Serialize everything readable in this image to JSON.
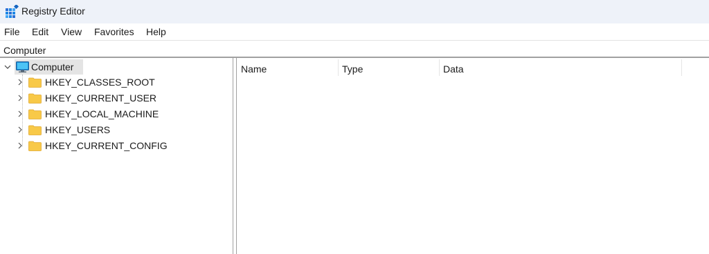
{
  "window": {
    "title": "Registry Editor",
    "icon": "registry-editor-icon"
  },
  "menu": {
    "items": [
      {
        "label": "File"
      },
      {
        "label": "Edit"
      },
      {
        "label": "View"
      },
      {
        "label": "Favorites"
      },
      {
        "label": "Help"
      }
    ]
  },
  "address": {
    "path": "Computer"
  },
  "tree": {
    "root": {
      "label": "Computer",
      "icon": "computer-icon",
      "expanded": true,
      "selected": true
    },
    "children": [
      {
        "label": "HKEY_CLASSES_ROOT",
        "icon": "folder-icon"
      },
      {
        "label": "HKEY_CURRENT_USER",
        "icon": "folder-icon"
      },
      {
        "label": "HKEY_LOCAL_MACHINE",
        "icon": "folder-icon"
      },
      {
        "label": "HKEY_USERS",
        "icon": "folder-icon"
      },
      {
        "label": "HKEY_CURRENT_CONFIG",
        "icon": "folder-icon"
      }
    ]
  },
  "list": {
    "columns": [
      {
        "label": "Name"
      },
      {
        "label": "Type"
      },
      {
        "label": "Data"
      }
    ]
  },
  "colors": {
    "titlebar": "#eef2f9",
    "folder": "#f8c948",
    "selection": "#e4e4e4"
  }
}
